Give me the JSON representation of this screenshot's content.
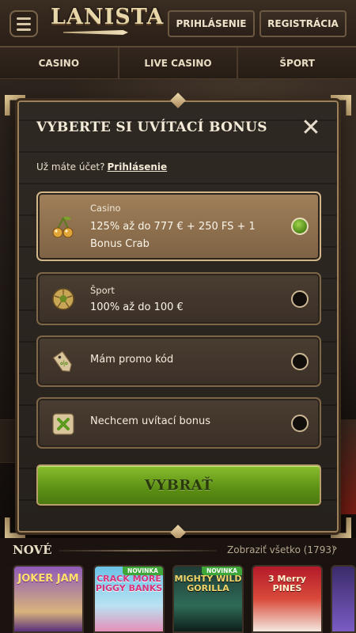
{
  "header": {
    "logo_text": "LANISTA",
    "login_label": "PRIHLÁSENIE",
    "register_label": "REGISTRÁCIA"
  },
  "nav": {
    "tabs": [
      "CASINO",
      "LIVE CASINO",
      "ŠPORT"
    ]
  },
  "modal": {
    "title": "VYBERTE SI UVÍTACÍ BONUS",
    "close_symbol": "✕",
    "account_prompt": "Už máte účet?",
    "account_link": "Prihlásenie",
    "options": [
      {
        "label": "Casino",
        "value": "125% až do 777 € + 250 FS + 1 Bonus Crab",
        "icon": "cherries-icon",
        "selected": true
      },
      {
        "label": "Šport",
        "value": "100% až do 100 €",
        "icon": "soccer-ball-icon",
        "selected": false
      },
      {
        "label": "Mám promo kód",
        "icon": "promo-tag-icon",
        "selected": false
      },
      {
        "label": "Nechcem uvítací bonus",
        "icon": "no-bonus-x-icon",
        "selected": false
      }
    ],
    "submit_label": "VYBRAŤ"
  },
  "games": {
    "section_title": "NOVÉ",
    "see_all": "Zobraziť všetko (1793)",
    "see_all_arrow": "›",
    "tiles": [
      {
        "name": "JOKER JAM",
        "badge": ""
      },
      {
        "name": "CRACK MORE PIGGY BANKS",
        "badge": "NOVINKA"
      },
      {
        "name": "MIGHTY WILD GORILLA",
        "badge": "NOVINKA"
      },
      {
        "name": "3 Merry PINES",
        "badge": ""
      }
    ]
  },
  "colors": {
    "accent_gold": "#c9a76f",
    "select_green": "#6fa11f",
    "radio_checked": "#7fb530"
  }
}
